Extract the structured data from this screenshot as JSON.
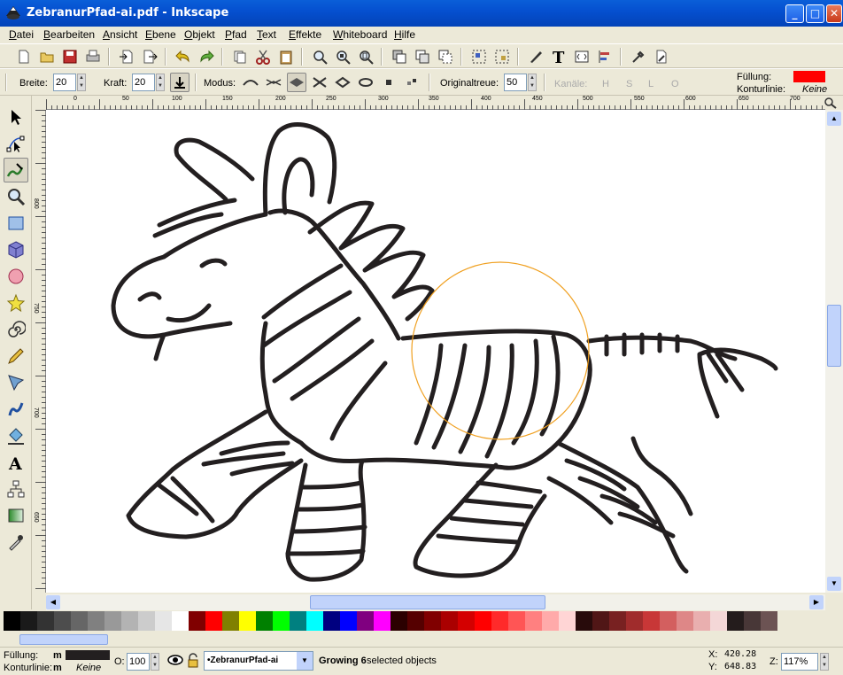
{
  "window": {
    "title": "ZebranurPfad-ai.pdf - Inkscape",
    "min": "_",
    "max": "□",
    "close": "✕"
  },
  "menu": [
    "Datei",
    "Bearbeiten",
    "Ansicht",
    "Ebene",
    "Objekt",
    "Pfad",
    "Text",
    "Effekte",
    "Whiteboard",
    "Hilfe"
  ],
  "controls": {
    "width_label": "Breite:",
    "width_value": "20",
    "force_label": "Kraft:",
    "force_value": "20",
    "mode_label": "Modus:",
    "fidelity_label": "Originaltreue:",
    "fidelity_value": "50",
    "channels_label": "Kanäle:",
    "channels": [
      "H",
      "S",
      "L",
      "O"
    ]
  },
  "style_indicator": {
    "fill_label": "Füllung:",
    "stroke_label": "Konturlinie:",
    "stroke_value": "Keine",
    "fill_color": "#ff0000"
  },
  "ruler": {
    "h_ticks": [
      "0",
      "50",
      "100",
      "150",
      "200",
      "250",
      "300",
      "350",
      "400",
      "450",
      "500",
      "550",
      "600",
      "650",
      "700"
    ],
    "v_ticks": [
      "800",
      "750",
      "700",
      "650"
    ]
  },
  "palette": [
    "#000000",
    "#1a1a1a",
    "#333333",
    "#4d4d4d",
    "#666666",
    "#808080",
    "#999999",
    "#b3b3b3",
    "#cccccc",
    "#e6e6e6",
    "#ffffff",
    "#800000",
    "#ff0000",
    "#808000",
    "#ffff00",
    "#008000",
    "#00ff00",
    "#008080",
    "#00ffff",
    "#000080",
    "#0000ff",
    "#800080",
    "#ff00ff",
    "#2b0000",
    "#550000",
    "#800000",
    "#aa0000",
    "#d40000",
    "#ff0000",
    "#ff2a2a",
    "#ff5555",
    "#ff8080",
    "#ffaaaa",
    "#ffd5d5",
    "#280b0b",
    "#501616",
    "#782121",
    "#a02c2c",
    "#c83737",
    "#d35f5f",
    "#de8787",
    "#e9afaf",
    "#f4d7d7",
    "#241c1c",
    "#483737",
    "#6c5353"
  ],
  "status": {
    "fill_label": "Füllung:",
    "fill_value": "m",
    "stroke_label": "Konturlinie:",
    "stroke_value": "m",
    "stroke_none": "Keine",
    "opacity_label": "O:",
    "opacity_value": "100",
    "layer": "•ZebranurPfad-ai",
    "message_bold": "Growing 6",
    "message_rest": " selected objects",
    "x_label": "X:",
    "x_value": "420.28",
    "y_label": "Y:",
    "y_value": "648.83",
    "zoom_label": "Z:",
    "zoom_value": "117%"
  },
  "colors": {
    "title_blue": "#0550d0",
    "toolbar_bg": "#ece9d8",
    "tweak_circle": "#f0a020"
  }
}
